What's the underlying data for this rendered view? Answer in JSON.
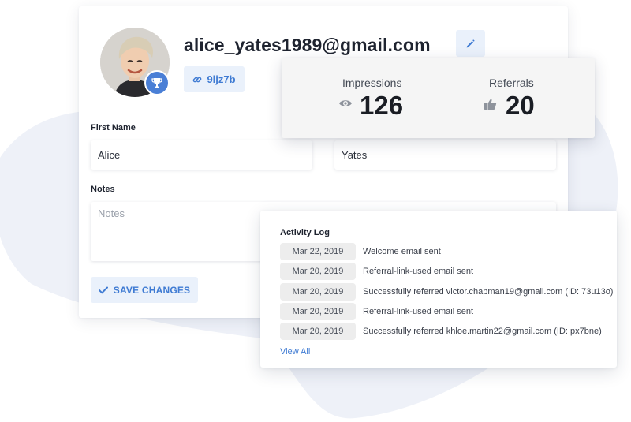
{
  "colors": {
    "accent": "#3f7bd3",
    "accent_soft": "#eaf1fb",
    "trophy_badge": "#4a7fd6",
    "background_blob": "#eef1f8"
  },
  "profile": {
    "email": "alice_yates1989@gmail.com",
    "referral_code": "9ljz7b",
    "avatar_icon": "user-avatar-photo",
    "badge_icon": "trophy-icon",
    "edit_icon": "pencil-icon",
    "code_icon": "link-icon"
  },
  "form": {
    "first_name_label": "First Name",
    "first_name_value": "Alice",
    "last_name_value": "Yates",
    "notes_label": "Notes",
    "notes_placeholder": "Notes",
    "save_label": "SAVE CHANGES",
    "save_icon": "check-icon"
  },
  "stats": {
    "impressions_label": "Impressions",
    "impressions_value": "126",
    "impressions_icon": "eye-icon",
    "referrals_label": "Referrals",
    "referrals_value": "20",
    "referrals_icon": "thumbs-up-icon"
  },
  "activity": {
    "title": "Activity Log",
    "rows": [
      {
        "date": "Mar 22, 2019",
        "message": "Welcome email sent"
      },
      {
        "date": "Mar 20, 2019",
        "message": "Referral-link-used email sent"
      },
      {
        "date": "Mar 20, 2019",
        "message": "Successfully referred victor.chapman19@gmail.com (ID: 73u13o)"
      },
      {
        "date": "Mar 20, 2019",
        "message": "Referral-link-used email sent"
      },
      {
        "date": "Mar 20, 2019",
        "message": "Successfully referred khloe.martin22@gmail.com (ID: px7bne)"
      }
    ],
    "view_all_label": "View All"
  }
}
